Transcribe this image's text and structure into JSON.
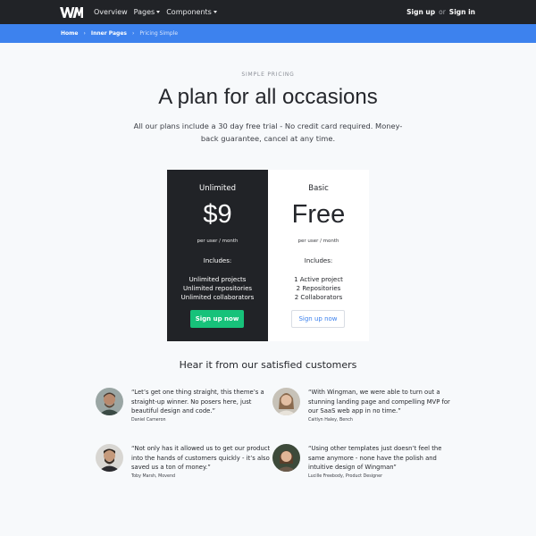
{
  "nav": {
    "logo": "Wingman logo",
    "links": [
      {
        "label": "Overview"
      },
      {
        "label": "Pages"
      },
      {
        "label": "Components"
      }
    ],
    "signup": "Sign up",
    "or": "or",
    "signin": "Sign in"
  },
  "breadcrumb": {
    "home": "Home",
    "sep": "›",
    "inner": "Inner Pages",
    "current": "Pricing Simple"
  },
  "hero": {
    "eyebrow": "SIMPLE PRICING",
    "title": "A plan for all occasions",
    "lead": "All our plans include a 30 day free trial - No credit card required. Money-back guarantee, cancel at any time."
  },
  "plans": [
    {
      "name": "Unlimited",
      "price": "$9",
      "per": "per user / month",
      "includes": "Includes:",
      "features": [
        "Unlimited projects",
        "Unlimited repositories",
        "Unlimited collaborators"
      ],
      "cta": "Sign up now"
    },
    {
      "name": "Basic",
      "price": "Free",
      "per": "per user / month",
      "includes": "Includes:",
      "features": [
        "1 Active project",
        "2 Repositories",
        "2 Collaborators"
      ],
      "cta": "Sign up now"
    }
  ],
  "testimonials": {
    "heading": "Hear it from our satisfied customers",
    "items": [
      {
        "quote": "“Let’s get one thing straight, this theme’s a straight-up winner. No posers here, just beautiful design and code.”",
        "author": "Daniel Cameron"
      },
      {
        "quote": "“With Wingman, we were able to turn out a stunning landing page and compelling MVP for our SaaS web app in no time.”",
        "author": "Caitlyn Haley, Bench"
      },
      {
        "quote": "“Not only has it allowed us to get our product into the hands of customers quickly - it’s also saved us a ton of money.”",
        "author": "Toby Marsh, Movend"
      },
      {
        "quote": "“Using other templates just doesn’t feel the same anymore - none have the polish and intuitive design of Wingman”",
        "author": "Lucille Freebody, Product Designer"
      }
    ]
  },
  "colors": {
    "navbar": "#212327",
    "breadcrumb": "#3d82ee",
    "success": "#17c27a",
    "page_bg": "#f7f9fb"
  }
}
